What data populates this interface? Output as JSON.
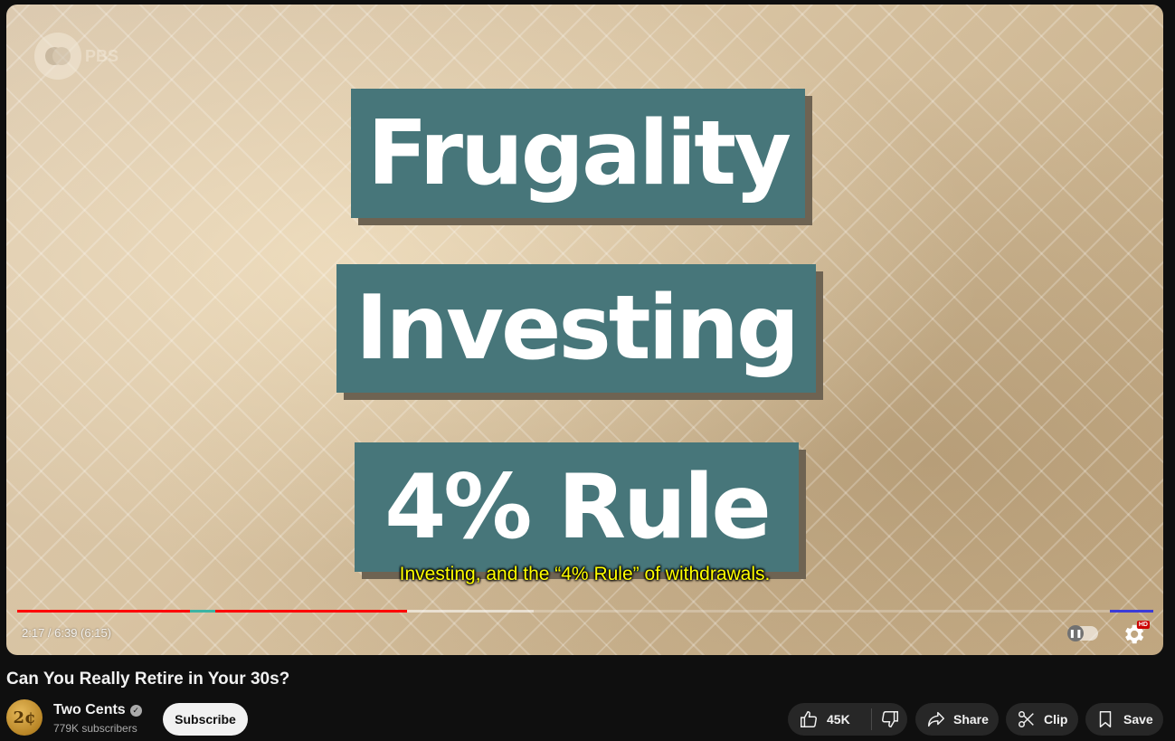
{
  "video": {
    "watermark": "PBS",
    "slide_words": [
      "Frugality",
      "Investing",
      "4% Rule"
    ],
    "caption": "Investing, and the “4% Rule” of withdrawals.",
    "time_display": "2:17 / 6:39 (6:15)",
    "progress": {
      "played_fraction": 0.343,
      "buffered_fraction": 0.455
    },
    "settings_badge": "HD",
    "colors": {
      "slide_box": "#47767a",
      "caption": "#ffff00",
      "progress_played": "#ff0000"
    }
  },
  "title": "Can You Really Retire in Your 30s?",
  "channel": {
    "avatar_text": "2¢",
    "name": "Two Cents",
    "subscribers": "779K subscribers",
    "subscribe_label": "Subscribe"
  },
  "actions": {
    "likes": "45K",
    "share_label": "Share",
    "clip_label": "Clip",
    "save_label": "Save"
  }
}
